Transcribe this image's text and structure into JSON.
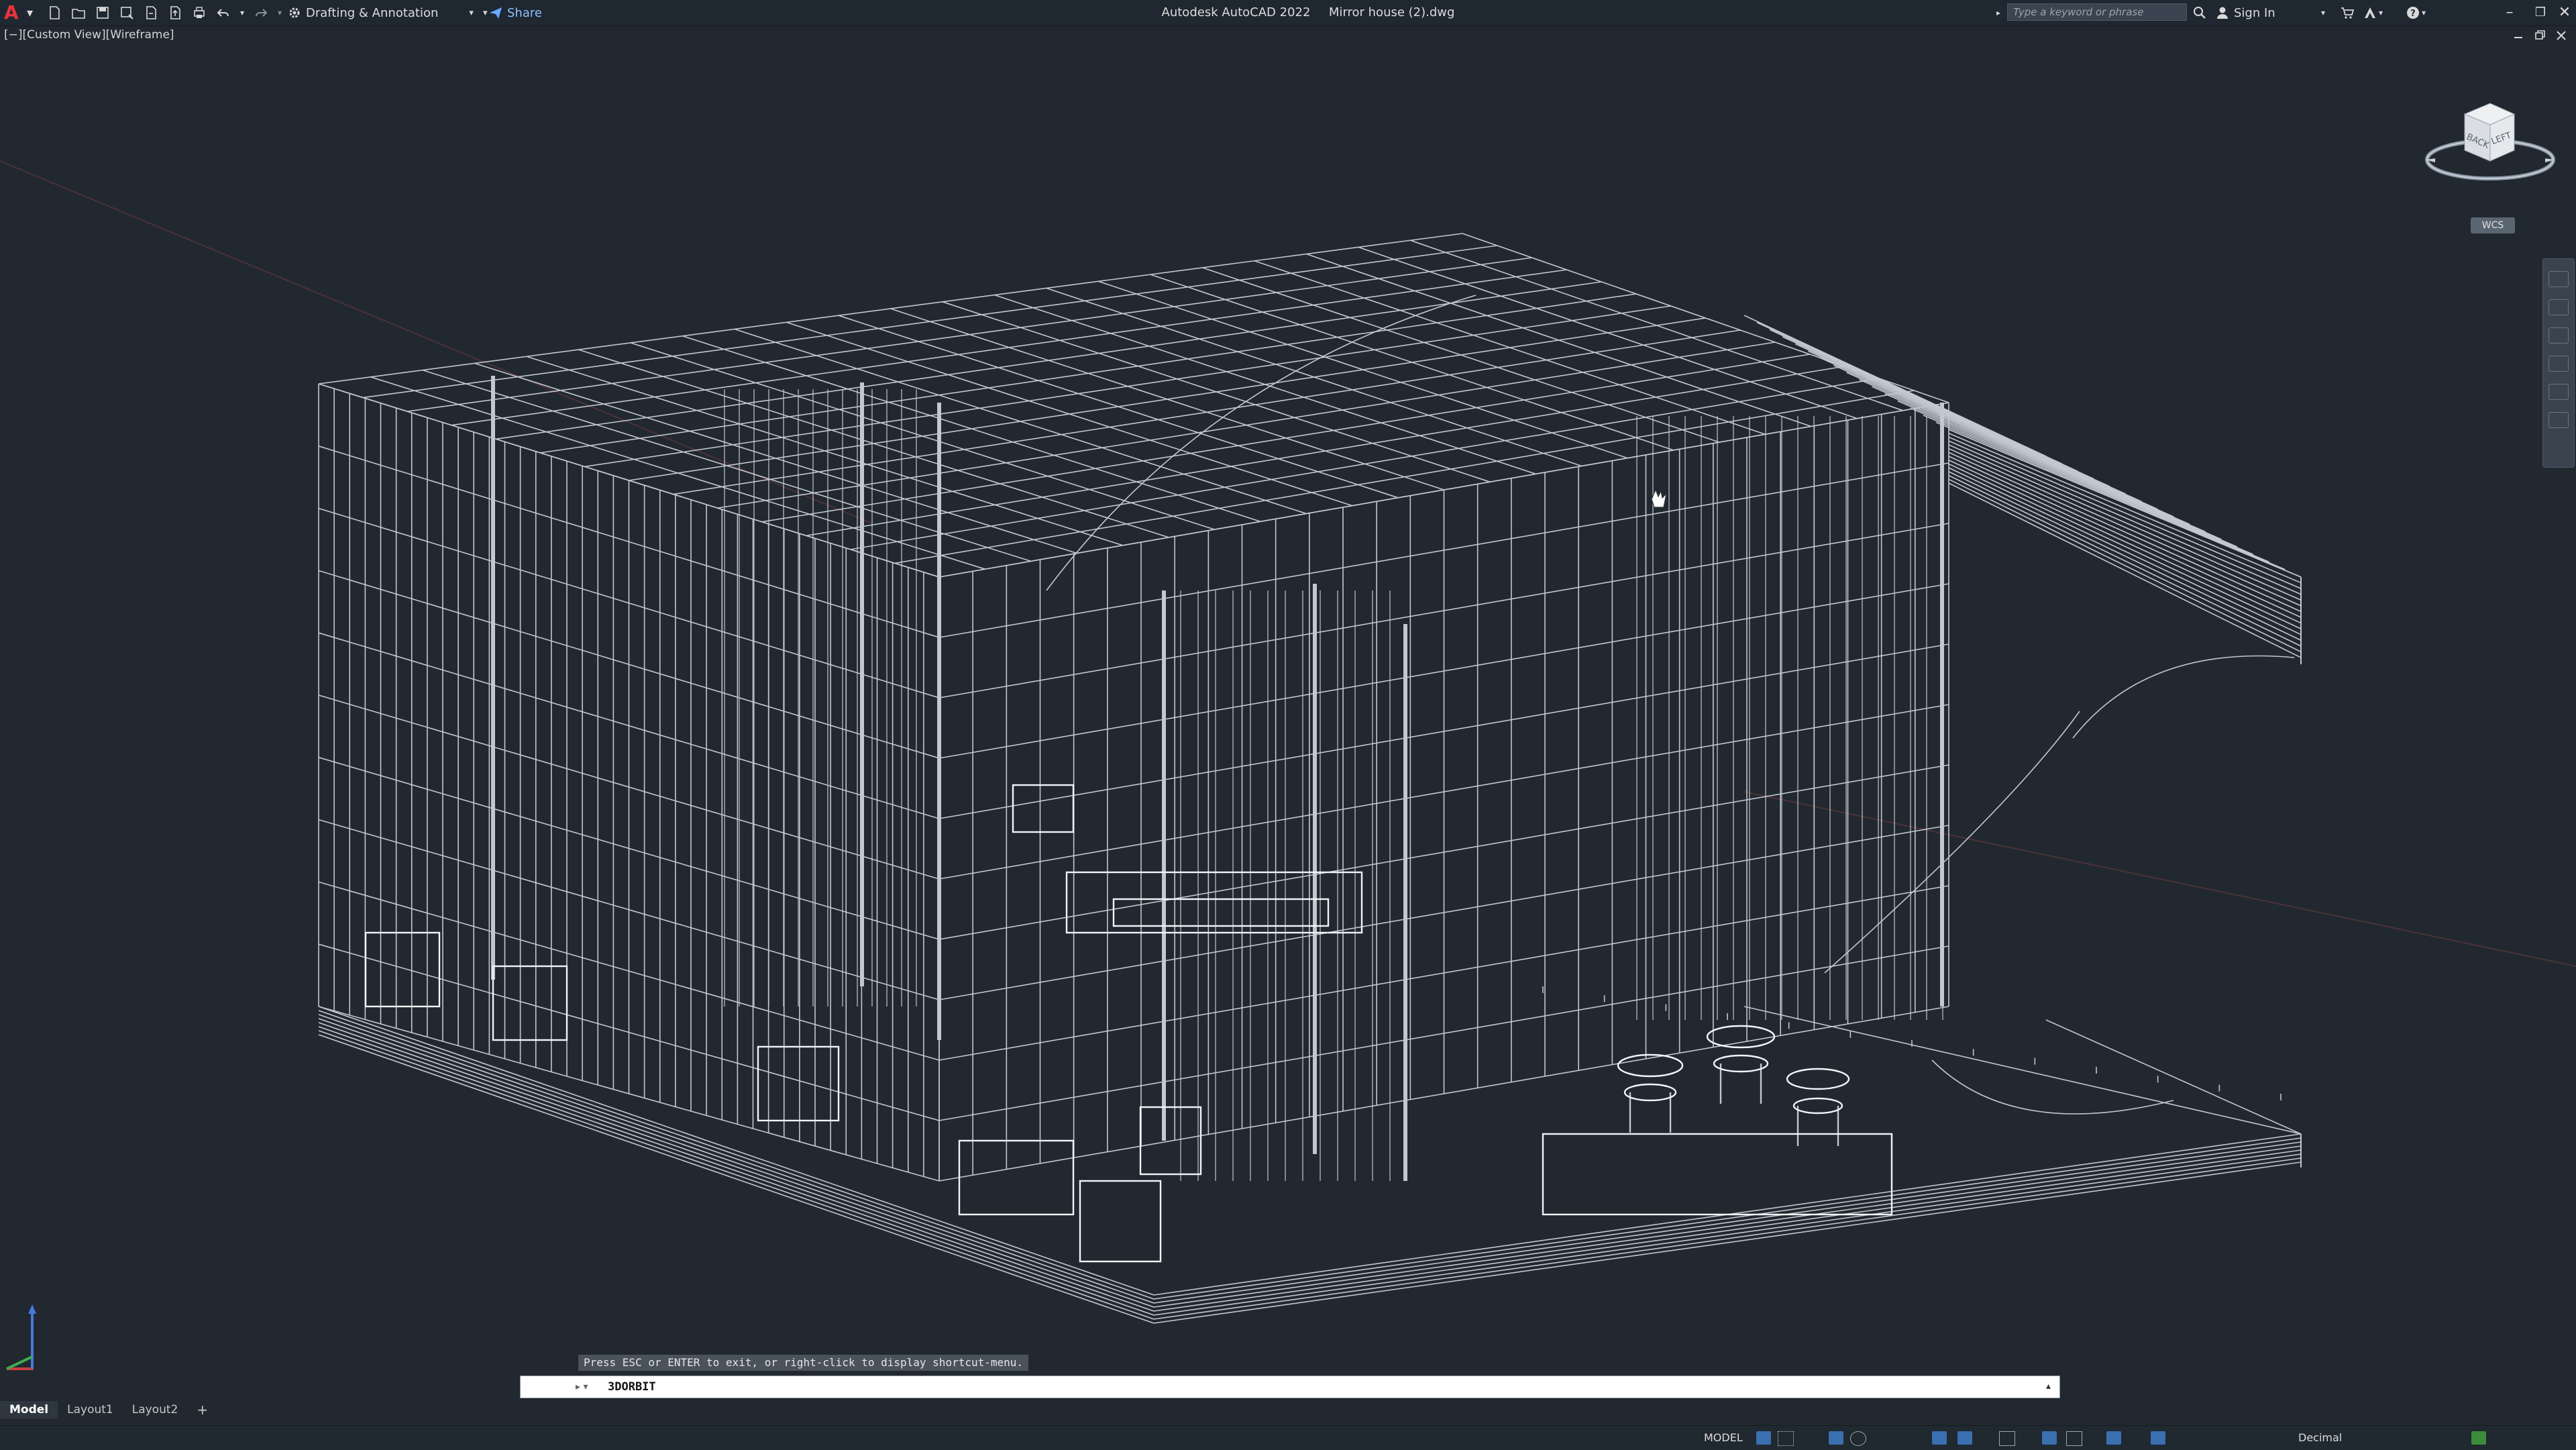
{
  "titlebar": {
    "app_name": "Autodesk AutoCAD 2022",
    "document_name": "Mirror house (2).dwg",
    "workspace": "Drafting & Annotation",
    "share_label": "Share",
    "search_placeholder": "Type a keyword or phrase",
    "sign_in_label": "Sign In",
    "quick_access_icons": [
      "new-icon",
      "open-icon",
      "save-icon",
      "save-as-icon",
      "open-from-web-icon",
      "save-to-web-icon",
      "plot-icon",
      "undo-icon",
      "redo-icon",
      "gear-icon"
    ]
  },
  "viewport": {
    "label": "[−][Custom View][Wireframe]",
    "viewcube_faces": [
      "BACK",
      "LEFT"
    ],
    "ucs_badge": "WCS"
  },
  "command": {
    "hint": "Press ESC or ENTER to exit, or right-click to display shortcut-menu.",
    "current": "3DORBIT"
  },
  "layout_tabs": [
    "Model",
    "Layout1",
    "Layout2"
  ],
  "add_tab_label": "+",
  "statusbar": {
    "mode": "MODEL",
    "units": "Decimal"
  },
  "colors": {
    "background": "#212830",
    "wireframe": "#e8eef4",
    "accent_blue": "#3a6fb0"
  }
}
